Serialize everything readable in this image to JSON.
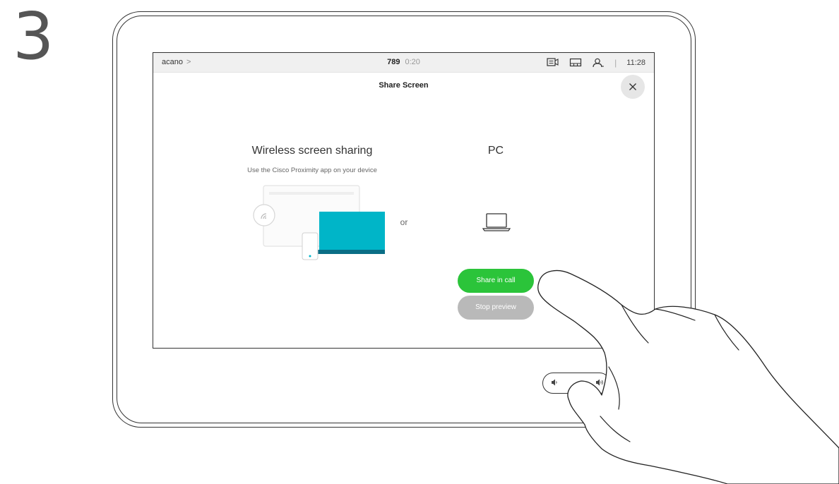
{
  "step": "3",
  "status_bar": {
    "location": "acano",
    "location_chevron": ">",
    "call_number": "789",
    "call_timer": "0:20",
    "separator": "|",
    "clock": "11:28",
    "icons": [
      "self-view-icon",
      "layout-icon",
      "participants-icon"
    ]
  },
  "panel": {
    "title": "Share Screen",
    "close_icon": "close-icon"
  },
  "wireless": {
    "heading": "Wireless screen sharing",
    "subtitle": "Use the Cisco Proximity app on your device"
  },
  "or_label": "or",
  "pc": {
    "heading": "PC"
  },
  "buttons": {
    "share_label": "Share in call",
    "stop_label": "Stop preview"
  },
  "colors": {
    "share_green": "#2bc43a",
    "stop_gray": "#b9b9b9",
    "laptop_teal": "#00b5c8",
    "laptop_base": "#0a6e86"
  }
}
